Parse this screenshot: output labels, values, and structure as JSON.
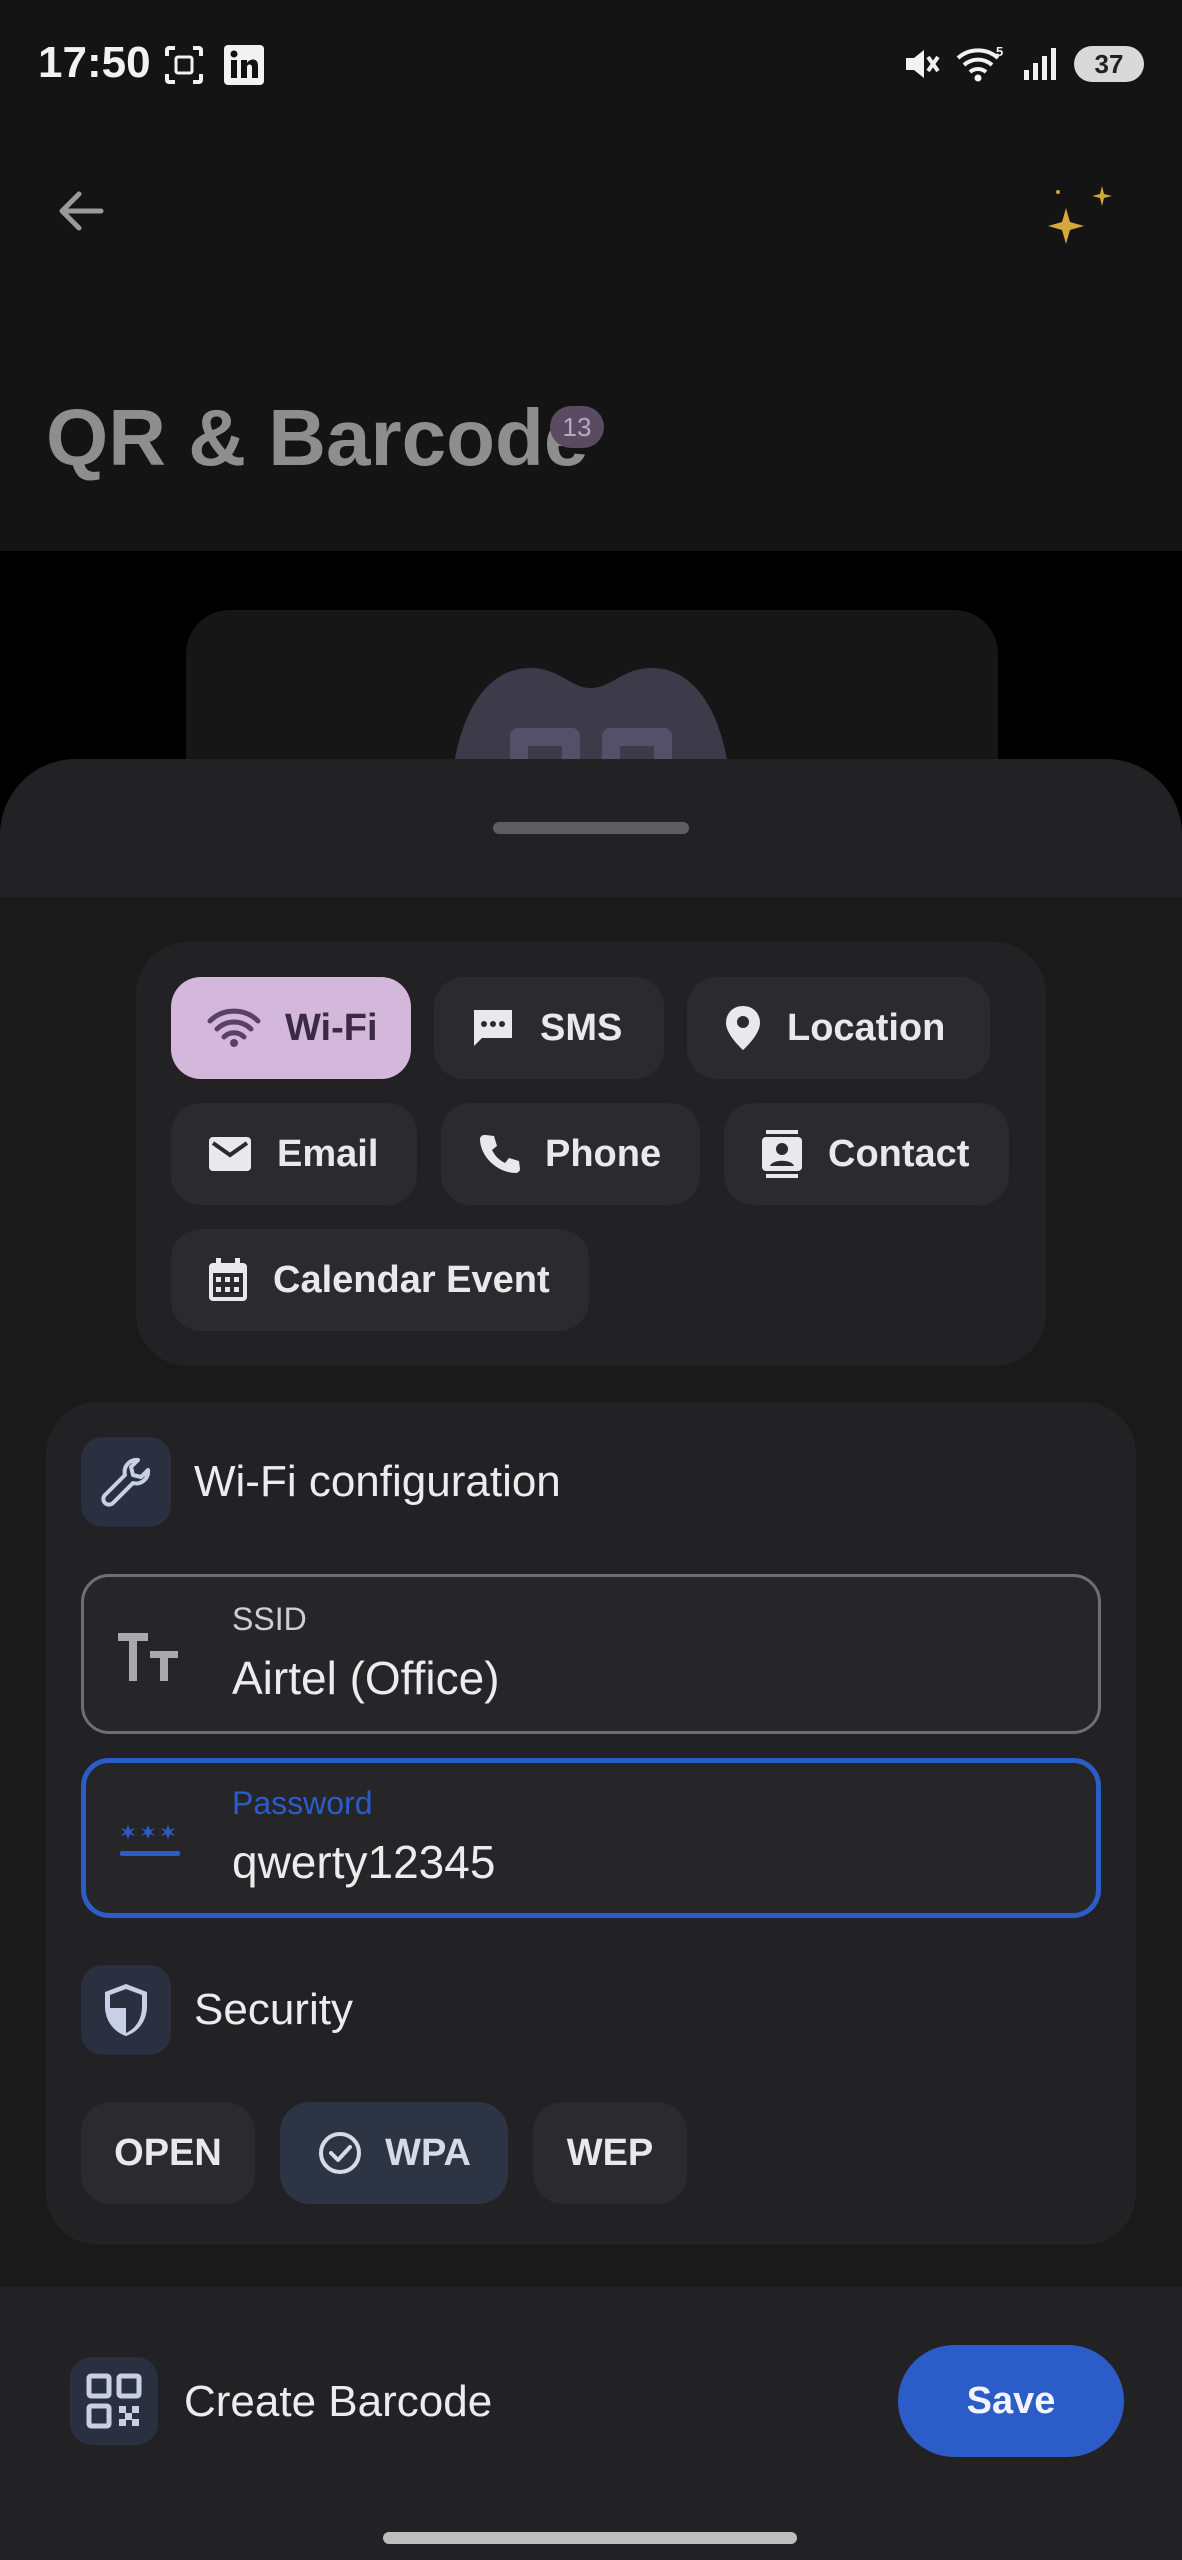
{
  "status_bar": {
    "time": "17:50",
    "battery": "37",
    "wifi_label": "5"
  },
  "header": {
    "title": "QR & Barcode",
    "badge": "13"
  },
  "types": [
    {
      "label": "Wi-Fi",
      "icon": "wifi-icon",
      "selected": true
    },
    {
      "label": "SMS",
      "icon": "sms-icon",
      "selected": false
    },
    {
      "label": "Location",
      "icon": "location-pin-icon",
      "selected": false
    },
    {
      "label": "Email",
      "icon": "email-icon",
      "selected": false
    },
    {
      "label": "Phone",
      "icon": "phone-icon",
      "selected": false
    },
    {
      "label": "Contact",
      "icon": "contact-icon",
      "selected": false
    },
    {
      "label": "Calendar Event",
      "icon": "calendar-icon",
      "selected": false
    }
  ],
  "config": {
    "title": "Wi-Fi configuration",
    "ssid": {
      "label": "SSID",
      "value": "Airtel (Office)"
    },
    "password": {
      "label": "Password",
      "value": "qwerty12345"
    },
    "security_title": "Security",
    "security_options": [
      {
        "label": "OPEN",
        "selected": false
      },
      {
        "label": "WPA",
        "selected": true
      },
      {
        "label": "WEP",
        "selected": false
      }
    ]
  },
  "bottom_bar": {
    "label": "Create Barcode",
    "save_label": "Save"
  },
  "colors": {
    "accent": "#2c5cc8",
    "selected_chip": "#d3b8db",
    "sparkle": "#d4a83a"
  }
}
